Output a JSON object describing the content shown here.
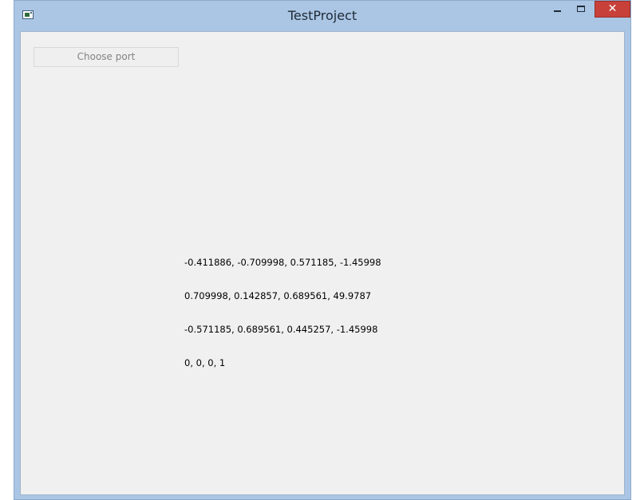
{
  "window": {
    "title": "TestProject"
  },
  "icons": {
    "app": "app-window-icon",
    "minimize": "minimize-icon",
    "maximize": "maximize-icon",
    "close": "close-icon"
  },
  "titlebar_buttons": {
    "close_glyph": "✕"
  },
  "colors": {
    "titlebar": "#aac6e4",
    "client_background": "#f0f0f0",
    "close_button": "#c7413a"
  },
  "controls": {
    "choose_port_label": "Choose port"
  },
  "matrix": {
    "rows": [
      "-0.411886, -0.709998, 0.571185, -1.45998",
      "0.709998, 0.142857, 0.689561, 49.9787",
      "-0.571185, 0.689561, 0.445257, -1.45998",
      "0, 0, 0, 1"
    ]
  }
}
